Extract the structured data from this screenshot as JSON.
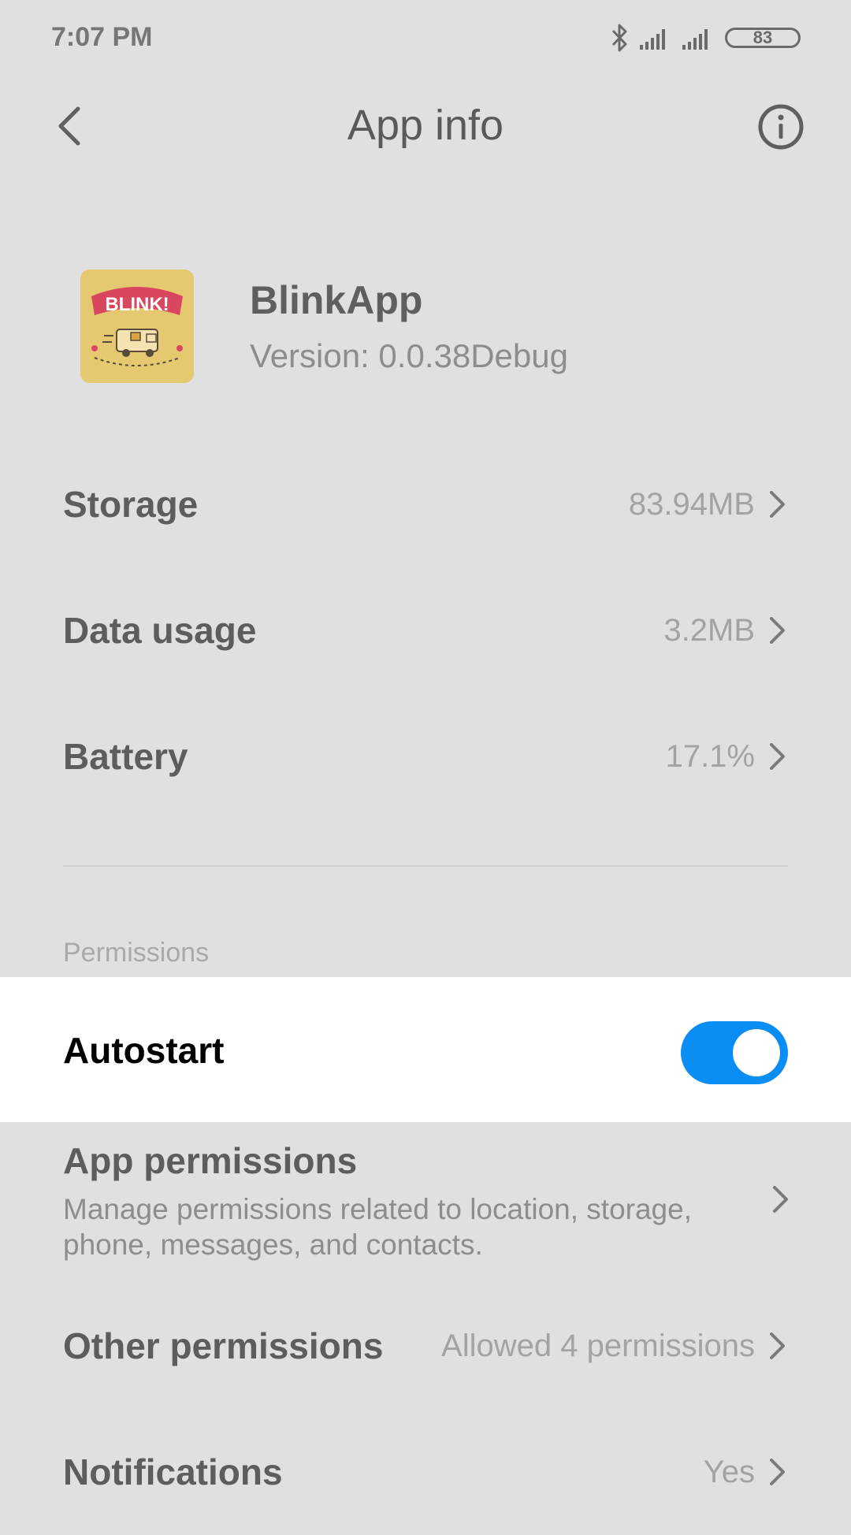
{
  "status_bar": {
    "time": "7:07 PM",
    "battery": "83",
    "icons": [
      "bluetooth-icon",
      "signal-icon",
      "signal-icon"
    ]
  },
  "header": {
    "title": "App info",
    "back_icon": "back-arrow-icon",
    "info_icon": "info-icon"
  },
  "app": {
    "name": "BlinkApp",
    "version": "Version: 0.0.38Debug",
    "icon_text": "BLINK!"
  },
  "rows": [
    {
      "label": "Storage",
      "value": "83.94MB"
    },
    {
      "label": "Data usage",
      "value": "3.2MB"
    },
    {
      "label": "Battery",
      "value": "17.1%"
    }
  ],
  "permissions": {
    "section_label": "Permissions",
    "autostart": {
      "label": "Autostart",
      "enabled": true
    },
    "app_permissions": {
      "label": "App permissions",
      "description": "Manage permissions related to location, storage, phone, messages, and contacts."
    },
    "other_permissions": {
      "label": "Other permissions",
      "value": "Allowed 4 permissions"
    },
    "notifications": {
      "label": "Notifications",
      "value": "Yes"
    }
  },
  "colors": {
    "background": "#e0e0e0",
    "highlight": "#ffffff",
    "toggle_on": "#0b8ef4"
  }
}
